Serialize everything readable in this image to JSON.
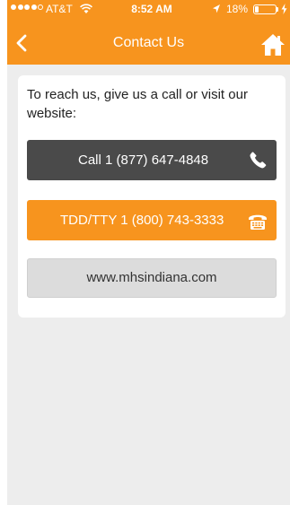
{
  "status_bar": {
    "carrier": "AT&T",
    "time": "8:52 AM",
    "battery": "18%",
    "signal_bars_filled": 4,
    "signal_bars_total": 5,
    "battery_level": 0.18,
    "icons": [
      "wifi-icon",
      "location-icon",
      "battery-icon",
      "charging-icon"
    ]
  },
  "nav": {
    "title": "Contact Us",
    "back_icon": "chevron-left-icon",
    "home_icon": "home-icon"
  },
  "content": {
    "intro": "To reach us, give us a call or visit our website:",
    "call_button": {
      "label": "Call 1 (877) 647-4848",
      "icon": "phone-icon"
    },
    "tdd_button": {
      "label": "TDD/TTY 1 (800) 743-3333",
      "icon": "tty-phone-icon"
    },
    "web_button": {
      "label": "www.mhsindiana.com"
    }
  },
  "colors": {
    "header": "#f7941e",
    "call_button": "#4a4a4a",
    "tdd_button": "#f7941e",
    "web_button": "#dcdcdc",
    "background": "#ededed"
  }
}
